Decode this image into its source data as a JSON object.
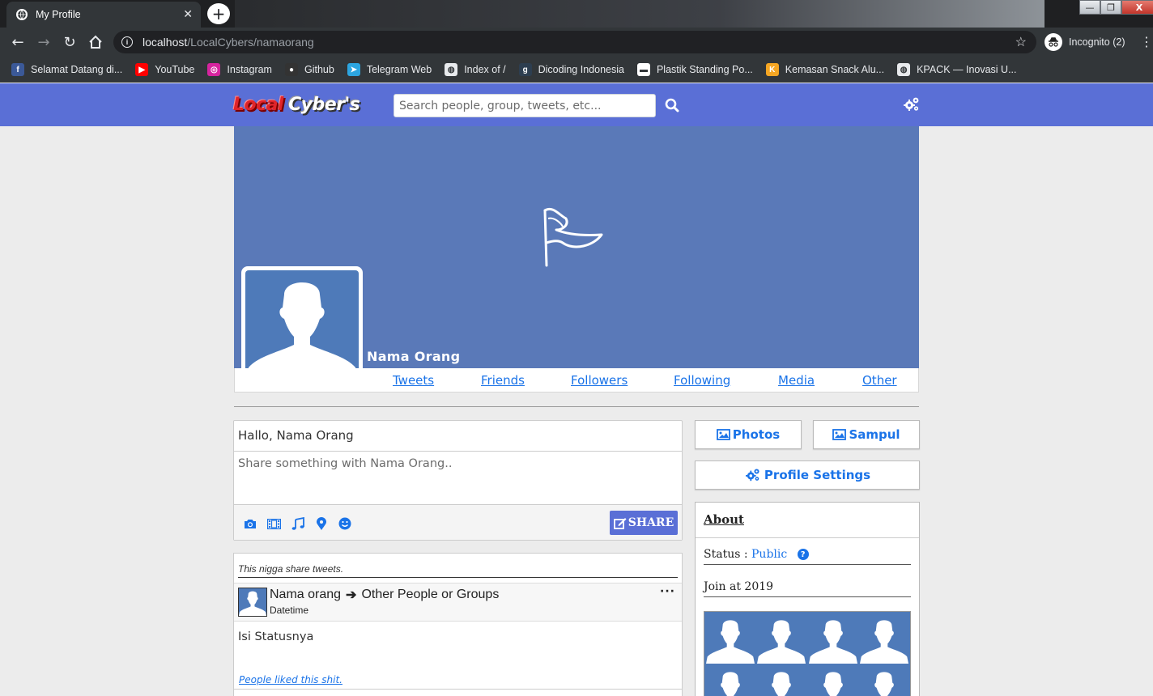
{
  "browser": {
    "tab_title": "My Profile",
    "url_host": "localhost",
    "url_path": "/LocalCybers/namaorang",
    "incognito_label": "Incognito (2)",
    "bookmarks": [
      {
        "label": "Selamat Datang di...",
        "icon": "facebook-icon",
        "color": "#3b5998"
      },
      {
        "label": "YouTube",
        "icon": "youtube-icon",
        "color": "#ff0000"
      },
      {
        "label": "Instagram",
        "icon": "instagram-icon",
        "color": "#d6249f"
      },
      {
        "label": "Github",
        "icon": "github-icon",
        "color": "#333333"
      },
      {
        "label": "Telegram Web",
        "icon": "telegram-icon",
        "color": "#2ca5e0"
      },
      {
        "label": "Index of /",
        "icon": "globe-icon",
        "color": "#e8eaed"
      },
      {
        "label": "Dicoding Indonesia",
        "icon": "dicoding-icon",
        "color": "#2d3e50"
      },
      {
        "label": "Plastik Standing Po...",
        "icon": "plastik-icon",
        "color": "#ffffff"
      },
      {
        "label": "Kemasan Snack Alu...",
        "icon": "kemasan-icon",
        "color": "#f5a623"
      },
      {
        "label": "KPACK — Inovasi U...",
        "icon": "globe-icon",
        "color": "#e8eaed"
      }
    ]
  },
  "app": {
    "logo_part1": "Local",
    "logo_part2": "Cyber's",
    "search_placeholder": "Search people, group, tweets, etc...",
    "accent_color": "#5a6fd6",
    "cover_color": "#5a79b8"
  },
  "profile": {
    "name": "Nama Orang",
    "tabs": [
      "Tweets",
      "Friends",
      "Followers",
      "Following",
      "Media",
      "Other"
    ]
  },
  "composer": {
    "greeting": "Hallo, Nama Orang",
    "placeholder": "Share something with Nama Orang..",
    "share_label": "SHARE",
    "tools": [
      "camera-icon",
      "film-icon",
      "music-icon",
      "location-icon",
      "smile-icon"
    ]
  },
  "post": {
    "note": "This nigga share tweets.",
    "author": "Nama orang",
    "target": "Other People or Groups",
    "date": "Datetime",
    "content": "Isi Statusnya",
    "liked": "People liked this shit."
  },
  "sidebar": {
    "photos_label": "Photos",
    "sampul_label": "Sampul",
    "settings_label": "Profile Settings",
    "about_title": "About",
    "status_label": "Status : ",
    "status_value": "Public",
    "join_label": "Join at 2019",
    "friend_count_visible": 8
  }
}
